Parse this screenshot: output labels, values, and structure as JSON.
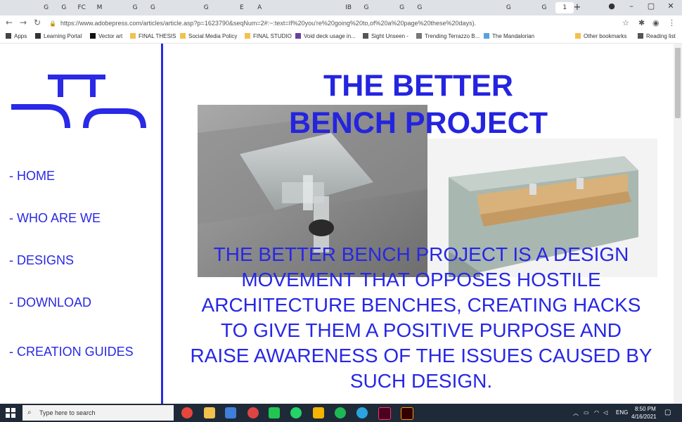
{
  "browser": {
    "tabs": [
      "",
      "",
      "G",
      "G",
      "FC",
      "M",
      "",
      "G",
      "G",
      "",
      "",
      "G",
      "",
      "E",
      "A",
      "",
      "",
      "",
      "",
      "IB",
      "G",
      "",
      "G",
      "G",
      "",
      "",
      "",
      "",
      "G",
      "",
      "G",
      "1"
    ],
    "new_tab": "+",
    "url": "https://www.adobepress.com/articles/article.asp?p=1623790&seqNum=2#:~:text=If%20you're%20going%20to,of%20a%20page%20these%20days).",
    "bookmarks": [
      "Apps",
      "Learning Portal",
      "Vector art",
      "FINAL THESIS",
      "Social Media Policy",
      "FINAL STUDIO",
      "Void deck usage in...",
      "Sight Unseen -",
      "Trending Terrazzo B...",
      "The Mandalorian",
      "Other bookmarks",
      "Reading list"
    ]
  },
  "sidebar": {
    "nav": [
      "- HOME",
      "- WHO ARE WE",
      "- DESIGNS",
      "- DOWNLOAD",
      "- CREATION GUIDES"
    ]
  },
  "main": {
    "title_line1": "THE BETTER",
    "title_line2": "BENCH PROJECT",
    "description": "THE BETTER BENCH PROJECT IS A DESIGN MOVEMENT THAT OPPOSES HOSTILE ARCHITECTURE BENCHES, CREATING HACKS TO GIVE THEM A POSITIVE PURPOSE AND RAISE AWARENESS OF THE ISSUES CAUSED BY SUCH DESIGN."
  },
  "taskbar": {
    "search_placeholder": "Type here to search",
    "lang": "ENG",
    "time": "8:50 PM",
    "date": "4/16/2021"
  },
  "colors": {
    "accent": "#2929e6"
  }
}
